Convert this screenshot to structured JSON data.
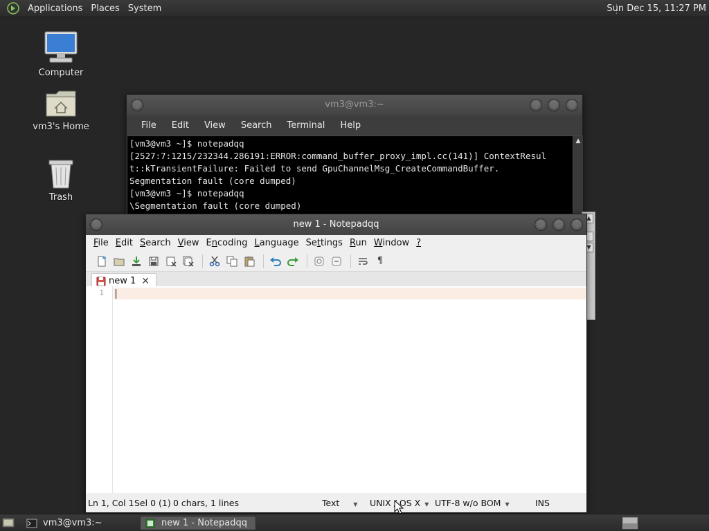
{
  "top_panel": {
    "menus": [
      "Applications",
      "Places",
      "System"
    ],
    "clock": "Sun Dec 15, 11:27 PM"
  },
  "desktop": {
    "icons": [
      {
        "label": "Computer",
        "icon": "computer-icon"
      },
      {
        "label": "vm3's Home",
        "icon": "home-folder-icon"
      },
      {
        "label": "Trash",
        "icon": "trash-icon"
      }
    ]
  },
  "terminal": {
    "title": "vm3@vm3:~",
    "menus": [
      "File",
      "Edit",
      "View",
      "Search",
      "Terminal",
      "Help"
    ],
    "lines": [
      "[vm3@vm3 ~]$ notepadqq",
      "[2527:7:1215/232344.286191:ERROR:command_buffer_proxy_impl.cc(141)] ContextResul",
      "t::kTransientFailure: Failed to send GpuChannelMsg_CreateCommandBuffer.",
      "Segmentation fault (core dumped)",
      "[vm3@vm3 ~]$ notepadqq",
      "\\Segmentation fault (core dumped)"
    ]
  },
  "notepadqq": {
    "title": "new 1 - Notepadqq",
    "menus": [
      {
        "pre": "",
        "key": "F",
        "post": "ile"
      },
      {
        "pre": "",
        "key": "E",
        "post": "dit"
      },
      {
        "pre": "",
        "key": "S",
        "post": "earch"
      },
      {
        "pre": "",
        "key": "V",
        "post": "iew"
      },
      {
        "pre": "E",
        "key": "n",
        "post": "coding"
      },
      {
        "pre": "",
        "key": "L",
        "post": "anguage"
      },
      {
        "pre": "Se",
        "key": "t",
        "post": "tings"
      },
      {
        "pre": "",
        "key": "R",
        "post": "un"
      },
      {
        "pre": "",
        "key": "W",
        "post": "indow"
      },
      {
        "pre": "",
        "key": "?",
        "post": ""
      }
    ],
    "tab_label": "new 1",
    "line_number": "1",
    "status": {
      "position": "Ln 1, Col 1",
      "selection": "Sel 0 (1)",
      "counts": "0 chars, 1 lines",
      "language": "Text",
      "eol": "UNIX / OS X",
      "encoding": "UTF-8 w/o BOM",
      "mode": "INS"
    }
  },
  "taskbar": {
    "tasks": [
      {
        "label": "vm3@vm3:~",
        "icon": "terminal-icon",
        "active": false
      },
      {
        "label": "new 1 - Notepadqq",
        "icon": "notepadqq-icon",
        "active": true
      }
    ]
  }
}
